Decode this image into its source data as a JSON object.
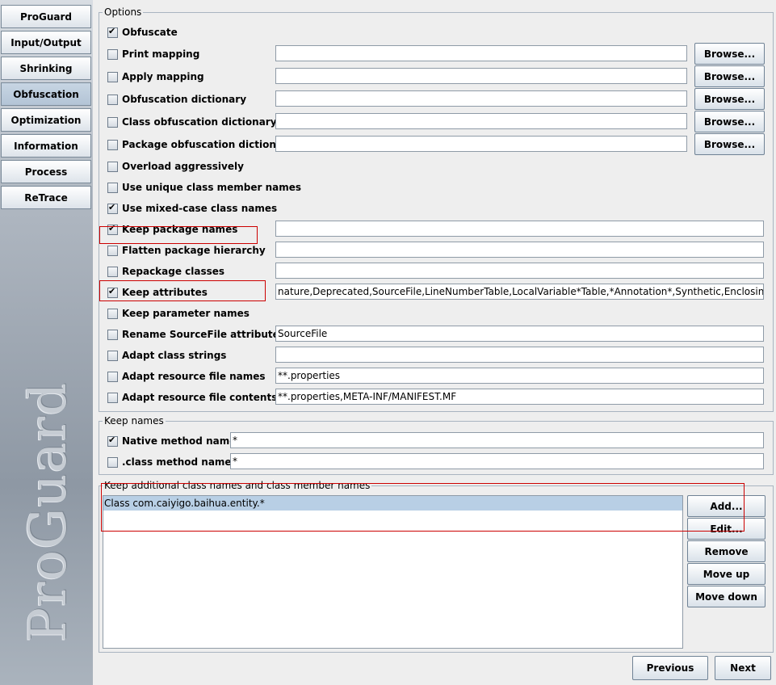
{
  "sidebar": {
    "items": [
      {
        "label": "ProGuard",
        "active": false
      },
      {
        "label": "Input/Output",
        "active": false
      },
      {
        "label": "Shrinking",
        "active": false
      },
      {
        "label": "Obfuscation",
        "active": true
      },
      {
        "label": "Optimization",
        "active": false
      },
      {
        "label": "Information",
        "active": false
      },
      {
        "label": "Process",
        "active": false
      },
      {
        "label": "ReTrace",
        "active": false
      }
    ],
    "logo_text": "ProGuard"
  },
  "options": {
    "title": "Options",
    "browse_label": "Browse...",
    "rows": [
      {
        "label": "Obfuscate",
        "checked": true
      },
      {
        "label": "Print mapping",
        "checked": false,
        "value": ""
      },
      {
        "label": "Apply mapping",
        "checked": false,
        "value": ""
      },
      {
        "label": "Obfuscation dictionary",
        "checked": false,
        "value": ""
      },
      {
        "label": "Class obfuscation dictionary",
        "checked": false,
        "value": ""
      },
      {
        "label": "Package obfuscation dictionary",
        "checked": false,
        "value": ""
      },
      {
        "label": "Overload aggressively",
        "checked": false
      },
      {
        "label": "Use unique class member names",
        "checked": false
      },
      {
        "label": "Use mixed-case class names",
        "checked": true
      },
      {
        "label": "Keep package names",
        "checked": true,
        "value": ""
      },
      {
        "label": "Flatten package hierarchy",
        "checked": false,
        "value": ""
      },
      {
        "label": "Repackage classes",
        "checked": false,
        "value": ""
      },
      {
        "label": "Keep attributes",
        "checked": true,
        "value": "nature,Deprecated,SourceFile,LineNumberTable,LocalVariable*Table,*Annotation*,Synthetic,EnclosingMethod"
      },
      {
        "label": "Keep parameter names",
        "checked": false
      },
      {
        "label": "Rename SourceFile attribute",
        "checked": false,
        "value": "SourceFile"
      },
      {
        "label": "Adapt class strings",
        "checked": false,
        "value": ""
      },
      {
        "label": "Adapt resource file names",
        "checked": false,
        "value": "**.properties"
      },
      {
        "label": "Adapt resource file contents",
        "checked": false,
        "value": "**.properties,META-INF/MANIFEST.MF"
      }
    ]
  },
  "keep_names": {
    "title": "Keep names",
    "rows": [
      {
        "label": "Native method names",
        "checked": true,
        "value": "*"
      },
      {
        "label": ".class method names",
        "checked": false,
        "value": "*"
      }
    ]
  },
  "keep_additional": {
    "title": "Keep additional class names and class member names",
    "items": [
      "Class com.caiyigo.baihua.entity.*"
    ],
    "buttons": {
      "add": "Add...",
      "edit": "Edit...",
      "remove": "Remove",
      "move_up": "Move up",
      "move_down": "Move down"
    }
  },
  "footer": {
    "previous": "Previous",
    "next": "Next"
  },
  "colors": {
    "highlight": "#cc0000",
    "selection": "#b8cfe5"
  }
}
